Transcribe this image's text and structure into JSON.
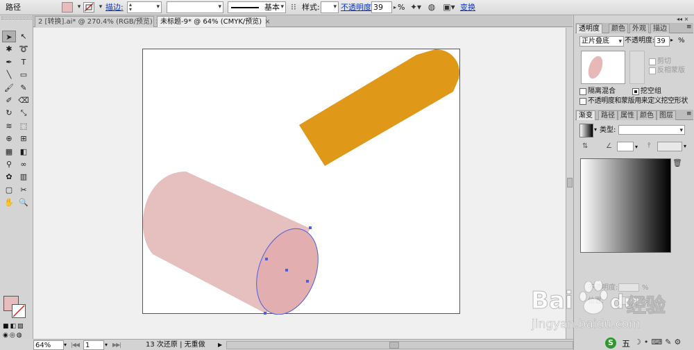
{
  "control_bar": {
    "object_type": "路径",
    "fill_color": "#e8bcbc",
    "stroke_label": "描边:",
    "stroke_weight": "",
    "brush_label": "基本",
    "style_label": "样式:",
    "opacity_label": "不透明度",
    "opacity_value": "39",
    "opacity_unit": "%",
    "transform_label": "变换"
  },
  "tabs": [
    {
      "label": "2 [转换].ai* @ 270.4% (RGB/预览)",
      "close": "×"
    },
    {
      "label": "未标题-9* @ 64% (CMYK/预览)",
      "close": "×"
    }
  ],
  "artwork": {
    "bar_color": "#df9818",
    "cylinder_color": "#e6bfbf",
    "cap_color": "#e2aeb0",
    "selection_color": "#4c5fe0"
  },
  "toolbox": {
    "tools": [
      "selection",
      "direct-selection",
      "magic-wand",
      "lasso",
      "pen",
      "type",
      "line",
      "rectangle",
      "paintbrush",
      "pencil",
      "blob-brush",
      "eraser",
      "rotate",
      "scale",
      "warp",
      "free-transform",
      "shape-builder",
      "perspective",
      "mesh",
      "gradient",
      "eyedropper",
      "blend",
      "symbol-sprayer",
      "graph",
      "artboard",
      "slice",
      "hand",
      "zoom"
    ],
    "fill_color": "#e8bcbc"
  },
  "status_bar": {
    "zoom": "64%",
    "page": "1",
    "undo_text": "13 次还原 | 无重做"
  },
  "transparency_panel": {
    "tabs": [
      "透明度",
      "颜色",
      "外观",
      "描边"
    ],
    "blend_mode": "正片叠底",
    "opacity_label": "不透明度:",
    "opacity_value": "39",
    "opacity_unit": "%",
    "clip_label": "剪切",
    "invert_mask_label": "反相蒙版",
    "isolate_blending_label": "隔离混合",
    "knockout_group_label": "挖空组",
    "opacity_mask_label": "不透明度和蒙版用来定义挖空形状"
  },
  "gradient_panel": {
    "tabs": [
      "渐变",
      "路径",
      "属性",
      "颜色",
      "图层"
    ],
    "type_label": "类型:",
    "opacity_label": "不透明度:",
    "location_label": "位置:",
    "percent": "%"
  },
  "watermark": {
    "brand_a": "Bai",
    "brand_b": "du",
    "brand_c": "经验",
    "url": "jingyan.baidu.com"
  },
  "tray": {
    "ime": "五"
  }
}
